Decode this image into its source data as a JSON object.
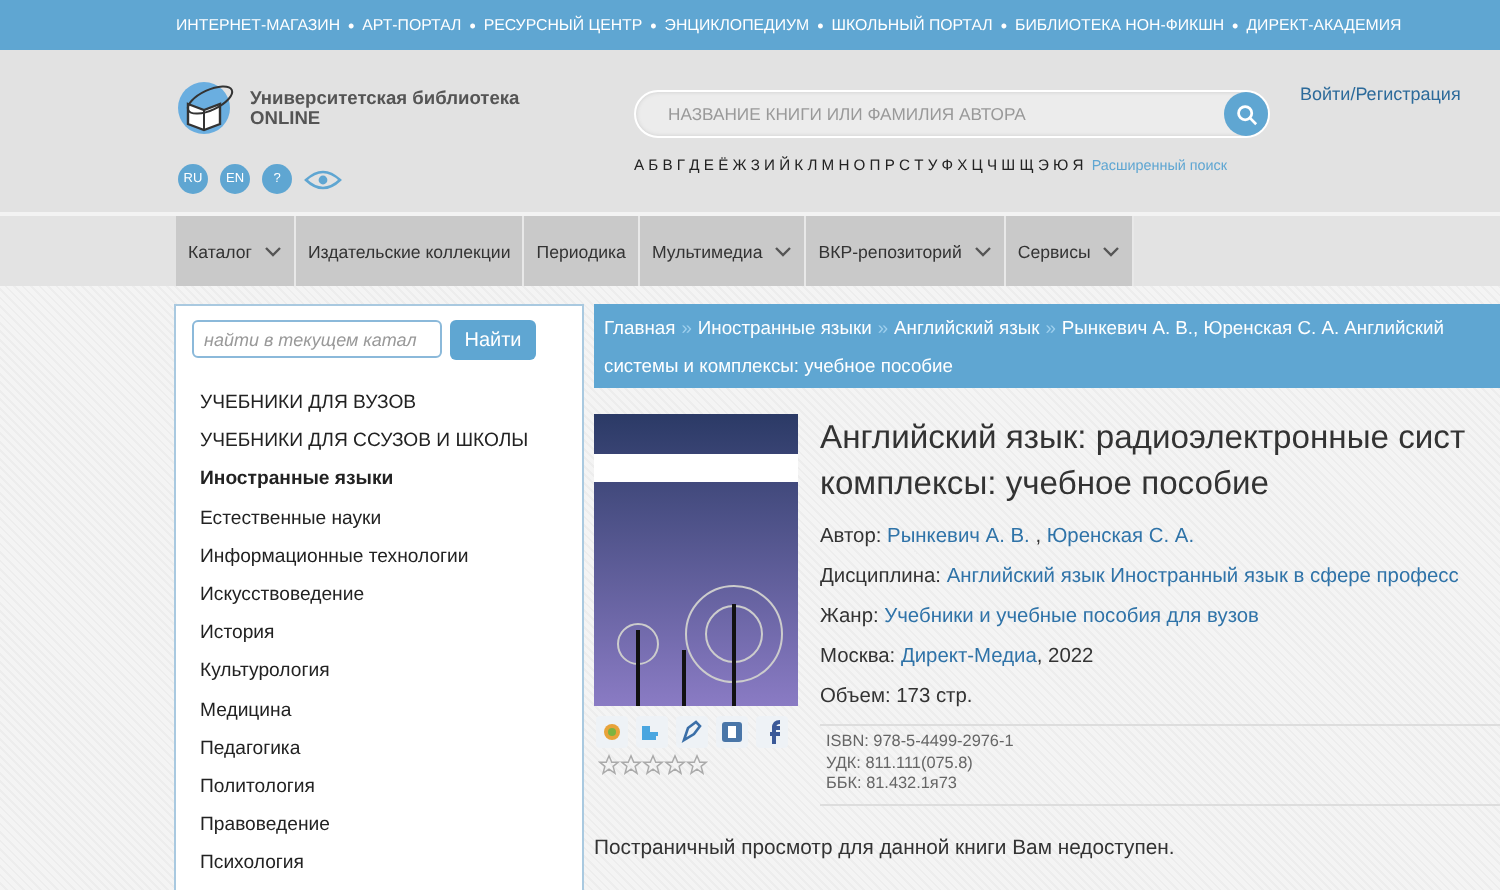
{
  "top_links": [
    "ИНТЕРНЕТ-МАГАЗИН",
    "АРТ-ПОРТАЛ",
    "РЕСУРСНЫЙ ЦЕНТР",
    "ЭНЦИКЛОПЕДИУМ",
    "ШКОЛЬНЫЙ ПОРТАЛ",
    "БИБЛИОТЕКА НОН-ФИКШН",
    "ДИРЕКТ-АКАДЕМИЯ"
  ],
  "top_separator": "•",
  "logo": {
    "line_1": "Университетская библиотека",
    "line_2": "ONLINE"
  },
  "language_buttons": [
    "RU",
    "EN",
    "?"
  ],
  "search": {
    "placeholder": "НАЗВАНИЕ КНИГИ ИЛИ ФАМИЛИЯ АВТОРА"
  },
  "alphabet": [
    "А",
    "Б",
    "В",
    "Г",
    "Д",
    "Е",
    "Ё",
    "Ж",
    "З",
    "И",
    "Й",
    "К",
    "Л",
    "М",
    "Н",
    "О",
    "П",
    "Р",
    "С",
    "Т",
    "У",
    "Ф",
    "Х",
    "Ц",
    "Ч",
    "Ш",
    "Щ",
    "Э",
    "Ю",
    "Я"
  ],
  "advanced_search": "Расширенный поиск",
  "login": {
    "sign_in": "Войти",
    "separator": "/",
    "register": "Регистрация"
  },
  "nav": [
    {
      "label": "Каталог",
      "has_menu": true
    },
    {
      "label": "Издательские коллекции",
      "has_menu": false
    },
    {
      "label": "Периодика",
      "has_menu": false
    },
    {
      "label": "Мультимедиа",
      "has_menu": true
    },
    {
      "label": "ВКР-репозиторий",
      "has_menu": true
    },
    {
      "label": "Сервисы",
      "has_menu": true
    }
  ],
  "sidebar": {
    "search_placeholder": "найти в текущем катал",
    "search_button": "Найти",
    "items": [
      {
        "label": "УЧЕБНИКИ ДЛЯ ВУЗОВ",
        "selected": false
      },
      {
        "label": "УЧЕБНИКИ ДЛЯ ССУЗОВ И ШКОЛЫ",
        "selected": false
      },
      {
        "label": "Иностранные языки",
        "selected": true
      },
      {
        "label": "Естественные науки",
        "selected": false
      },
      {
        "label": "Информационные технологии",
        "selected": false
      },
      {
        "label": "Искусствоведение",
        "selected": false
      },
      {
        "label": "История",
        "selected": false
      },
      {
        "label": "Культурология",
        "selected": false
      },
      {
        "label": "Медицина",
        "selected": false
      },
      {
        "label": "Педагогика",
        "selected": false
      },
      {
        "label": "Политология",
        "selected": false
      },
      {
        "label": "Правоведение",
        "selected": false
      },
      {
        "label": "Психология",
        "selected": false
      }
    ]
  },
  "breadcrumb": {
    "separator": "»",
    "items": [
      "Главная",
      "Иностранные языки",
      "Английский язык",
      "Рынкевич А. В., Юренская С. А. Английский"
    ],
    "continuation": "системы и комплексы: учебное пособие"
  },
  "book": {
    "title_lines": [
      "Английский язык: радиоэлектронные сист",
      "комплексы: учебное пособие"
    ],
    "details": [
      {
        "label": "Автор:",
        "links": [
          "Рынкевич А. В.",
          "Юренская С. А."
        ],
        "separator": " , "
      },
      {
        "label": "Дисциплина:",
        "links": [
          "Английский язык",
          "Иностранный язык в сфере професс"
        ]
      },
      {
        "label": "Жанр:",
        "links": [
          "Учебники и учебные пособия для вузов"
        ]
      },
      {
        "label": "Москва:",
        "links": [
          "Директ-Медиа"
        ],
        "suffix": ", 2022"
      },
      {
        "label": "Объем: 173 стр."
      }
    ],
    "codes": [
      "ISBN: 978-5-4499-2976-1",
      "УДК: 811.111(075.8)",
      "ББК: 81.432.1я73"
    ],
    "stars": 0
  },
  "notice": "Постраничный просмотр для данной книги Вам недоступен."
}
